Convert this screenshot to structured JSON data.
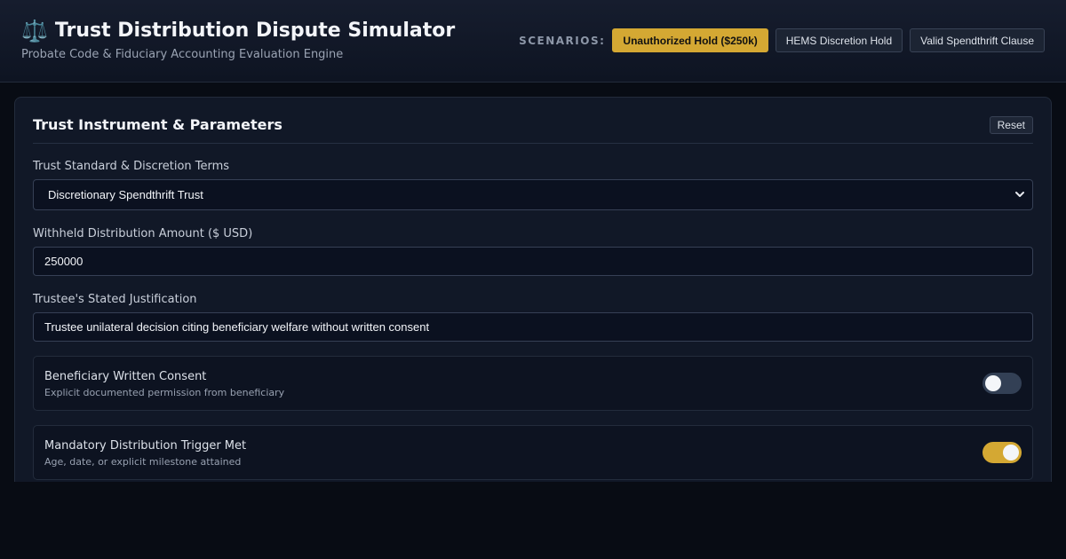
{
  "header": {
    "icon": "balance-scale-icon",
    "title_icon_glyph": "⚖️",
    "title": "Trust Distribution Dispute Simulator",
    "subtitle": "Probate Code & Fiduciary Accounting Evaluation Engine",
    "scenarios_label": "SCENARIOS:",
    "scenarios": [
      {
        "label": "Unauthorized Hold ($250k)",
        "active": true
      },
      {
        "label": "HEMS Discretion Hold",
        "active": false
      },
      {
        "label": "Valid Spendthrift Clause",
        "active": false
      }
    ]
  },
  "panel": {
    "title": "Trust Instrument & Parameters",
    "reset_label": "Reset",
    "trust_standard": {
      "label": "Trust Standard & Discretion Terms",
      "selected": "Discretionary Spendthrift Trust"
    },
    "withheld_amount": {
      "label": "Withheld Distribution Amount ($ USD)",
      "value": "250000"
    },
    "justification": {
      "label": "Trustee's Stated Justification",
      "value": "Trustee unilateral decision citing beneficiary welfare without written consent"
    },
    "toggles": [
      {
        "title": "Beneficiary Written Consent",
        "description": "Explicit documented permission from beneficiary",
        "on": false
      },
      {
        "title": "Mandatory Distribution Trigger Met",
        "description": "Age, date, or explicit milestone attained",
        "on": true
      }
    ]
  },
  "colors": {
    "accent": "#d4a833",
    "background": "#080c14",
    "panel": "#111827"
  }
}
